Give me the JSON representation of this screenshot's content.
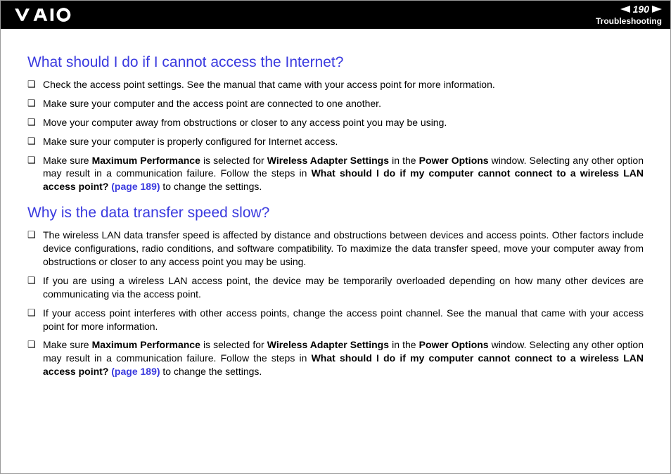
{
  "header": {
    "page_number": "190",
    "section": "Troubleshooting"
  },
  "section1": {
    "heading": "What should I do if I cannot access the Internet?",
    "items": [
      {
        "text": "Check the access point settings. See the manual that came with your access point for more information."
      },
      {
        "text": "Make sure your computer and the access point are connected to one another."
      },
      {
        "text": "Move your computer away from obstructions or closer to any access point you may be using."
      },
      {
        "text": "Make sure your computer is properly configured for Internet access."
      },
      {
        "pre": "Make sure ",
        "b1": "Maximum Performance",
        "mid1": " is selected for ",
        "b2": "Wireless Adapter Settings",
        "mid2": " in the ",
        "b3": "Power Options",
        "mid3": " window. Selecting any other option may result in a communication failure. Follow the steps in ",
        "b4": "What should I do if my computer cannot connect to a wireless LAN access point?",
        "link": " (page 189)",
        "post": " to change the settings."
      }
    ]
  },
  "section2": {
    "heading": "Why is the data transfer speed slow?",
    "items": [
      {
        "text": "The wireless LAN data transfer speed is affected by distance and obstructions between devices and access points. Other factors include device configurations, radio conditions, and software compatibility. To maximize the data transfer speed, move your computer away from obstructions or closer to any access point you may be using."
      },
      {
        "text": "If you are using a wireless LAN access point, the device may be temporarily overloaded depending on how many other devices are communicating via the access point."
      },
      {
        "text": "If your access point interferes with other access points, change the access point channel. See the manual that came with your access point for more information."
      },
      {
        "pre": "Make sure ",
        "b1": "Maximum Performance",
        "mid1": " is selected for ",
        "b2": "Wireless Adapter Settings",
        "mid2": " in the ",
        "b3": "Power Options",
        "mid3": " window. Selecting any other option may result in a communication failure. Follow the steps in ",
        "b4": "What should I do if my computer cannot connect to a wireless LAN access point?",
        "link": " (page 189)",
        "post": " to change the settings."
      }
    ]
  }
}
